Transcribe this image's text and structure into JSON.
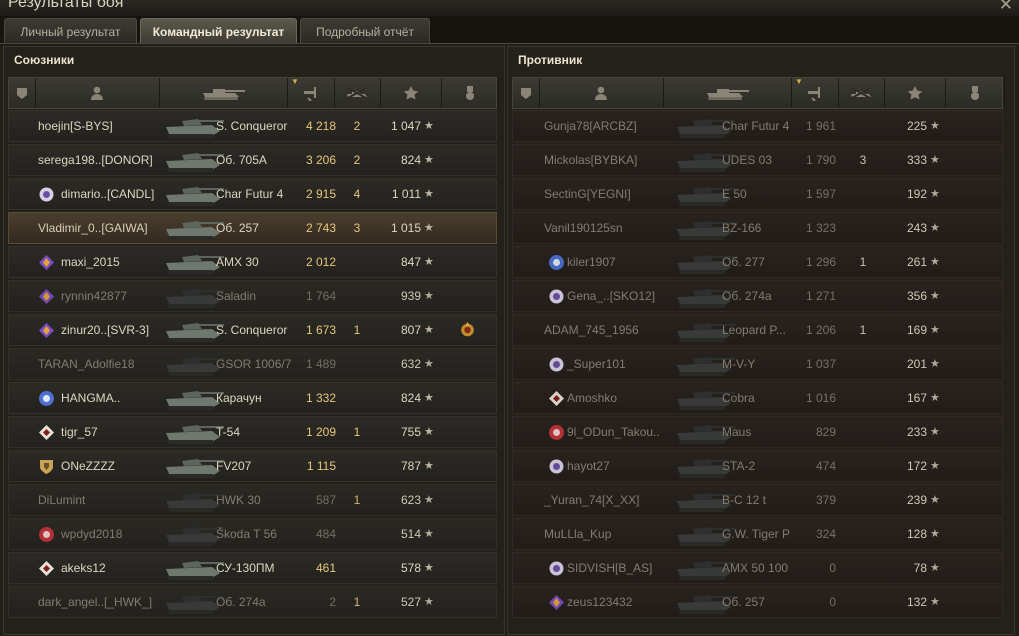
{
  "window": {
    "title": "Результаты боя",
    "close_label": "✕"
  },
  "tabs": [
    {
      "label": "Личный результат",
      "active": false
    },
    {
      "label": "Командный результат",
      "active": true
    },
    {
      "label": "Подробный отчёт",
      "active": false
    }
  ],
  "colors": {
    "accent": "#d4a949",
    "damage": "#e7c77a",
    "ally_row": "#2c2a25",
    "enemy_row": "#2a2320"
  },
  "header_icons": [
    "platoon-icon",
    "player-icon",
    "tank-icon",
    "damage-icon",
    "kills-icon",
    "xp-star-icon",
    "medal-icon"
  ],
  "allies": {
    "title": "Союзники",
    "rows": [
      {
        "player": "hoejin[S-BYS]",
        "badge": "",
        "vehicle": "S. Conqueror",
        "damage": "4 218",
        "kills": "2",
        "xp": "1 047",
        "dead": false,
        "medal": ""
      },
      {
        "player": "serega198..[DONOR]",
        "badge": "",
        "vehicle": "Об. 705А",
        "damage": "3 206",
        "kills": "2",
        "xp": "824",
        "dead": false,
        "medal": ""
      },
      {
        "player": "dimario..[CANDL]",
        "badge": "sun-rank-icon",
        "vehicle": "Char Futur 4",
        "damage": "2 915",
        "kills": "4",
        "xp": "1 011",
        "dead": false,
        "medal": ""
      },
      {
        "player": "Vladimir_0..[GAIWA]",
        "badge": "",
        "vehicle": "Об. 257",
        "damage": "2 743",
        "kills": "3",
        "xp": "1 015",
        "dead": false,
        "medal": "",
        "highlight": true
      },
      {
        "player": "maxi_2015",
        "badge": "purple-rank-icon",
        "vehicle": "AMX 30",
        "damage": "2 012",
        "kills": "",
        "xp": "847",
        "dead": false,
        "medal": ""
      },
      {
        "player": "rynnin42877",
        "badge": "purple-rank-icon",
        "vehicle": "Saladin",
        "damage": "1 764",
        "kills": "",
        "xp": "939",
        "dead": true,
        "medal": ""
      },
      {
        "player": "zinur20..[SVR-3]",
        "badge": "purple-rank-icon",
        "vehicle": "S. Conqueror",
        "damage": "1 673",
        "kills": "1",
        "xp": "807",
        "dead": false,
        "medal": "order-medal-icon"
      },
      {
        "player": "TARAN_Adolfie18",
        "badge": "",
        "vehicle": "GSOR 1006/7",
        "damage": "1 489",
        "kills": "",
        "xp": "632",
        "dead": true,
        "medal": ""
      },
      {
        "player": "HANGMA..",
        "badge": "blue-rank-icon",
        "vehicle": "Карачун",
        "damage": "1 332",
        "kills": "",
        "xp": "824",
        "dead": false,
        "medal": ""
      },
      {
        "player": "tigr_57",
        "badge": "diamond-rank-icon",
        "vehicle": "T-54",
        "damage": "1 209",
        "kills": "1",
        "xp": "755",
        "dead": false,
        "medal": ""
      },
      {
        "player": "ONeZZZZ",
        "badge": "shield-rank-icon",
        "vehicle": "FV207",
        "damage": "1 115",
        "kills": "",
        "xp": "787",
        "dead": false,
        "medal": ""
      },
      {
        "player": "DiLumint",
        "badge": "",
        "vehicle": "HWK 30",
        "damage": "587",
        "kills": "1",
        "xp": "623",
        "dead": true,
        "medal": ""
      },
      {
        "player": "wpdyd2018",
        "badge": "red-rank-icon",
        "vehicle": "Škoda T 56",
        "damage": "484",
        "kills": "",
        "xp": "514",
        "dead": true,
        "medal": ""
      },
      {
        "player": "akeks12",
        "badge": "diamond-rank-icon",
        "vehicle": "СУ-130ПМ",
        "damage": "461",
        "kills": "",
        "xp": "578",
        "dead": false,
        "medal": ""
      },
      {
        "player": "dark_angel..[_HWK_]",
        "badge": "",
        "vehicle": "Об. 274а",
        "damage": "2",
        "kills": "1",
        "xp": "527",
        "dead": true,
        "medal": ""
      }
    ]
  },
  "enemies": {
    "title": "Противник",
    "rows": [
      {
        "player": "Gunja78[ARCBZ]",
        "badge": "",
        "vehicle": "Char Futur 4",
        "damage": "1 961",
        "kills": "",
        "xp": "225",
        "dead": true
      },
      {
        "player": "Mickolas[BYBKA]",
        "badge": "",
        "vehicle": "UDES 03",
        "damage": "1 790",
        "kills": "3",
        "xp": "333",
        "dead": true
      },
      {
        "player": "SectinG[YEGNI]",
        "badge": "",
        "vehicle": "E 50",
        "damage": "1 597",
        "kills": "",
        "xp": "192",
        "dead": true
      },
      {
        "player": "Vanil190125sn",
        "badge": "",
        "vehicle": "BZ-166",
        "damage": "1 323",
        "kills": "",
        "xp": "243",
        "dead": true
      },
      {
        "player": "kiler1907",
        "badge": "blue-rank-icon",
        "vehicle": "Об. 277",
        "damage": "1 296",
        "kills": "1",
        "xp": "261",
        "dead": true
      },
      {
        "player": "Gena_..[SKO12]",
        "badge": "sun-rank-icon",
        "vehicle": "Об. 274а",
        "damage": "1 271",
        "kills": "",
        "xp": "356",
        "dead": true
      },
      {
        "player": "ADAM_745_1956",
        "badge": "",
        "vehicle": "Leopard P...",
        "damage": "1 206",
        "kills": "1",
        "xp": "169",
        "dead": true
      },
      {
        "player": "_Super101",
        "badge": "sun-rank-icon",
        "vehicle": "M-V-Y",
        "damage": "1 037",
        "kills": "",
        "xp": "201",
        "dead": true
      },
      {
        "player": "Amoshko",
        "badge": "diamond-rank-icon",
        "vehicle": "Cobra",
        "damage": "1 016",
        "kills": "",
        "xp": "167",
        "dead": true
      },
      {
        "player": "9l_ODun_Takou..",
        "badge": "red-rank-icon",
        "vehicle": "Maus",
        "damage": "829",
        "kills": "",
        "xp": "233",
        "dead": true
      },
      {
        "player": "hayot27",
        "badge": "sun-rank-icon",
        "vehicle": "STA-2",
        "damage": "474",
        "kills": "",
        "xp": "172",
        "dead": true
      },
      {
        "player": "_Yuran_74[X_XX]",
        "badge": "",
        "vehicle": "B-C 12 t",
        "damage": "379",
        "kills": "",
        "xp": "239",
        "dead": true
      },
      {
        "player": "MuLLla_Kup",
        "badge": "",
        "vehicle": "G.W. Tiger P",
        "damage": "324",
        "kills": "",
        "xp": "128",
        "dead": true
      },
      {
        "player": "SIDVISH[B_AS]",
        "badge": "sun-rank-icon",
        "vehicle": "AMX 50 100",
        "damage": "0",
        "kills": "",
        "xp": "78",
        "dead": true
      },
      {
        "player": "zeus123432",
        "badge": "purple-rank-icon",
        "vehicle": "Об. 257",
        "damage": "0",
        "kills": "",
        "xp": "132",
        "dead": true
      }
    ]
  }
}
